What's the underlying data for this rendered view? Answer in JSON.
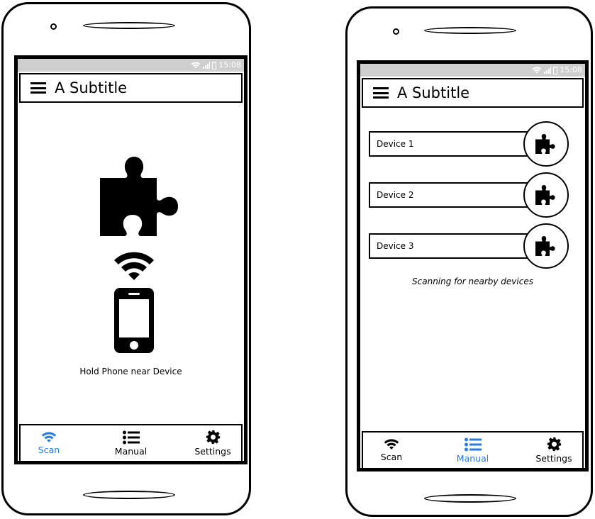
{
  "colors": {
    "accent": "#2b7be0",
    "statusbar": "#cfcfcf"
  },
  "phones": [
    {
      "status": {
        "icons": [
          "wifi-icon",
          "signal-icon",
          "battery-icon"
        ],
        "time": "15:08"
      },
      "appbar": {
        "menu_icon": "hamburger-menu-icon",
        "title": "A Subtitle"
      },
      "content": {
        "illustration": [
          "puzzle-piece-icon",
          "wifi-icon",
          "smartphone-icon"
        ],
        "hint": "Hold Phone near Device"
      },
      "tabs": [
        {
          "label": "Scan",
          "icon": "wifi-icon",
          "active": true
        },
        {
          "label": "Manual",
          "icon": "list-icon",
          "active": false
        },
        {
          "label": "Settings",
          "icon": "gear-icon",
          "active": false
        }
      ]
    },
    {
      "status": {
        "icons": [
          "wifi-icon",
          "signal-icon",
          "battery-icon"
        ],
        "time": "15:08"
      },
      "appbar": {
        "menu_icon": "hamburger-menu-icon",
        "title": "A Subtitle"
      },
      "content": {
        "devices": [
          {
            "name": "Device 1",
            "icon": "puzzle-piece-icon"
          },
          {
            "name": "Device 2",
            "icon": "puzzle-piece-icon"
          },
          {
            "name": "Device 3",
            "icon": "puzzle-piece-icon"
          }
        ],
        "scanning_text": "Scanning for nearby devices"
      },
      "tabs": [
        {
          "label": "Scan",
          "icon": "wifi-icon",
          "active": false
        },
        {
          "label": "Manual",
          "icon": "list-icon",
          "active": true
        },
        {
          "label": "Settings",
          "icon": "gear-icon",
          "active": false
        }
      ]
    }
  ]
}
